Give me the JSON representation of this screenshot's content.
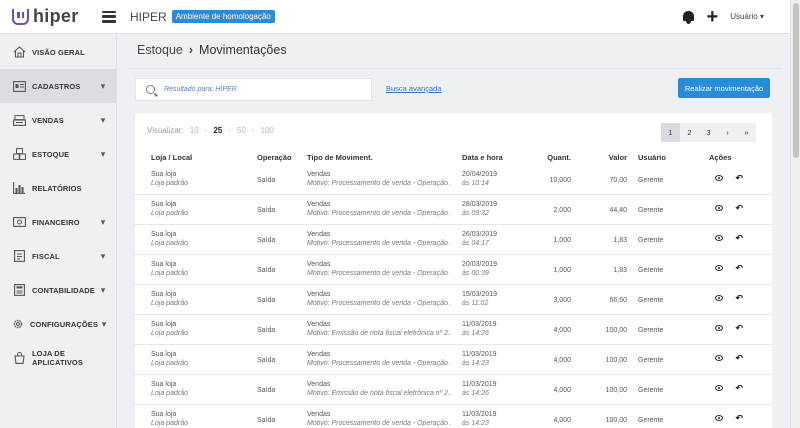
{
  "header": {
    "logo_text": "hiper",
    "app_title": "HIPER",
    "env_badge": "Ambiente de homologação",
    "user_menu": "Usuário ▾"
  },
  "sidebar": {
    "items": [
      {
        "label": "VISÃO GERAL",
        "icon": "home-icon",
        "chevron": ""
      },
      {
        "label": "CADASTROS",
        "icon": "id-card-icon",
        "chevron": "▾"
      },
      {
        "label": "VENDAS",
        "icon": "register-icon",
        "chevron": "▾"
      },
      {
        "label": "ESTOQUE",
        "icon": "boxes-icon",
        "chevron": "▾"
      },
      {
        "label": "RELATÓRIOS",
        "icon": "bar-chart-icon",
        "chevron": ""
      },
      {
        "label": "FINANCEIRO",
        "icon": "money-icon",
        "chevron": "▾"
      },
      {
        "label": "FISCAL",
        "icon": "document-icon",
        "chevron": "▾"
      },
      {
        "label": "CONTABILIDADE",
        "icon": "calculator-icon",
        "chevron": "▾"
      },
      {
        "label": "CONFIGURAÇÕES",
        "icon": "gear-icon",
        "chevron": "▾"
      },
      {
        "label": "LOJA DE APLICATIVOS",
        "icon": "app-store-icon",
        "chevron": ""
      }
    ]
  },
  "breadcrumb": {
    "parent": "Estoque",
    "separator": "›",
    "current": "Movimentações"
  },
  "search": {
    "placeholder": "Resultado para: HIPER",
    "value": ""
  },
  "advanced_search": "Busca avançada",
  "primary_action": "Realizar movimentação",
  "view": {
    "label": "Visualizar:",
    "options": [
      "10",
      "25",
      "50",
      "100"
    ],
    "selected": "25"
  },
  "pagination": {
    "pages": [
      "1",
      "2",
      "3"
    ],
    "next": "›",
    "last": "»",
    "current": "1"
  },
  "table": {
    "columns": [
      "Loja / Local",
      "Operação",
      "Tipo de Moviment.",
      "Data e hora",
      "Quant.",
      "Valor",
      "Usuário",
      "Ações"
    ],
    "rows": [
      {
        "store": "Sua loja",
        "local": "Loja padrão",
        "op": "Saída",
        "type": "Vendas",
        "reason": "Motivo: Processamento de venda - Operação ...",
        "date": "20/04/2019",
        "time": "às 10:14",
        "qty": "10,000",
        "value": "70,00",
        "user": "Gerente"
      },
      {
        "store": "Sua loja",
        "local": "Loja padrão",
        "op": "Saída",
        "type": "Vendas",
        "reason": "Motivo: Processamento de venda - Operação ...",
        "date": "28/03/2019",
        "time": "às 09:32",
        "qty": "2,000",
        "value": "44,40",
        "user": "Gerente"
      },
      {
        "store": "Sua loja",
        "local": "Loja padrão",
        "op": "Saída",
        "type": "Vendas",
        "reason": "Motivo: Processamento de venda - Operação ...",
        "date": "26/03/2019",
        "time": "às 04:17",
        "qty": "1,000",
        "value": "1,83",
        "user": "Gerente"
      },
      {
        "store": "Sua loja",
        "local": "Loja padrão",
        "op": "Saída",
        "type": "Vendas",
        "reason": "Motivo: Processamento de venda - Operação ...",
        "date": "20/03/2019",
        "time": "às 00:39",
        "qty": "1,000",
        "value": "1,83",
        "user": "Gerente"
      },
      {
        "store": "Sua loja",
        "local": "Loja padrão",
        "op": "Saída",
        "type": "Vendas",
        "reason": "Motivo: Processamento de venda - Operação ...",
        "date": "15/03/2019",
        "time": "às 11:02",
        "qty": "3,000",
        "value": "66,60",
        "user": "Gerente"
      },
      {
        "store": "Sua loja",
        "local": "Loja padrão",
        "op": "Saída",
        "type": "Vendas",
        "reason": "Motivo: Emissão de nota fiscal eletrônica nº 2...",
        "date": "11/03/2019",
        "time": "às 14:26",
        "qty": "4,000",
        "value": "100,00",
        "user": "Gerente"
      },
      {
        "store": "Sua loja",
        "local": "Loja padrão",
        "op": "Saída",
        "type": "Vendas",
        "reason": "Motivo: Processamento de venda - Operação ...",
        "date": "11/03/2019",
        "time": "às 14:23",
        "qty": "4,000",
        "value": "100,00",
        "user": "Gerente"
      },
      {
        "store": "Sua loja",
        "local": "Loja padrão",
        "op": "Saída",
        "type": "Vendas",
        "reason": "Motivo: Emissão de nota fiscal eletrônica nº 2...",
        "date": "11/03/2019",
        "time": "às 14:26",
        "qty": "4,000",
        "value": "100,00",
        "user": "Gerente"
      },
      {
        "store": "Sua loja",
        "local": "Loja padrão",
        "op": "Saída",
        "type": "Vendas",
        "reason": "Motivo: Processamento de venda - Operação ...",
        "date": "11/03/2019",
        "time": "às 14:23",
        "qty": "4,000",
        "value": "100,00",
        "user": "Gerente"
      }
    ]
  },
  "colors": {
    "accent": "#2a8bd8",
    "brand": "#6b4fbb",
    "link": "#3f6eb5"
  }
}
